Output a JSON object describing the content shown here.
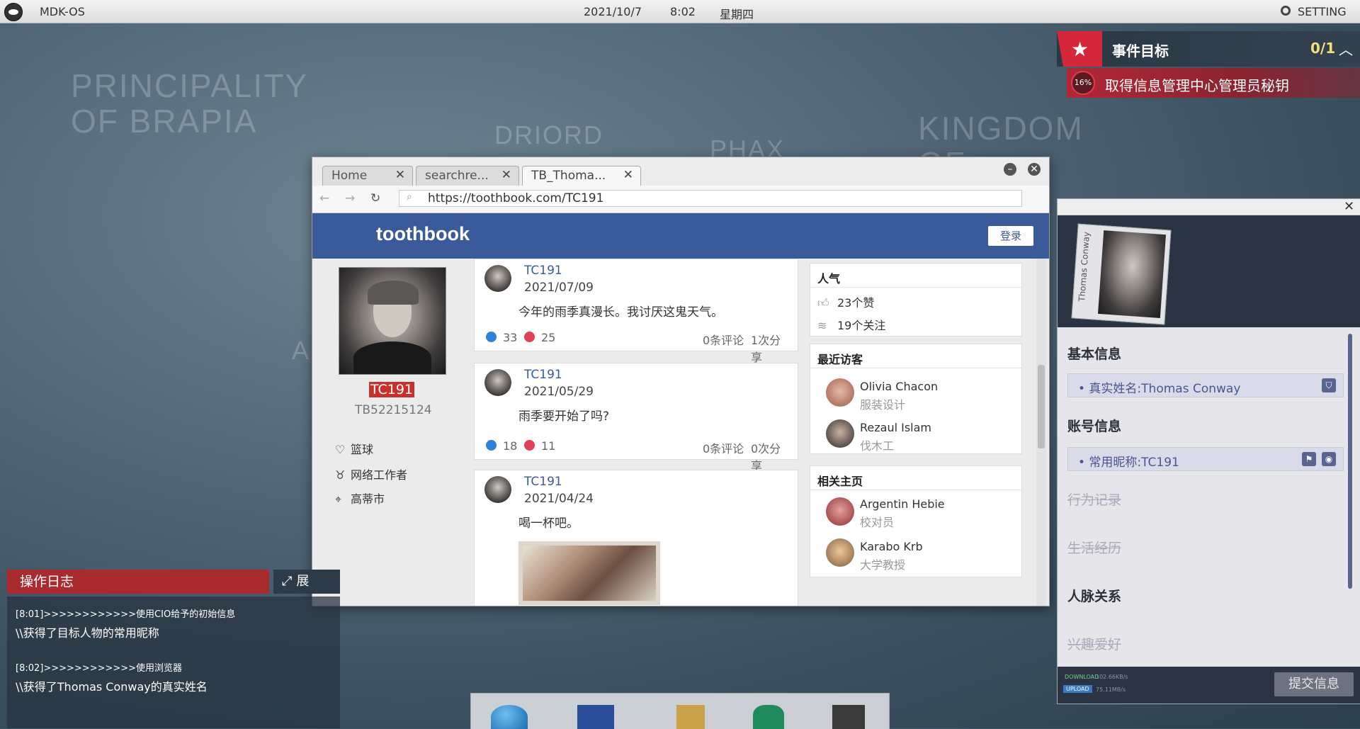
{
  "desktop": {
    "map_labels": [
      "PRINCIPALITY\nOF BRAPIA",
      "DRIORD",
      "PHAX",
      "KINGDOM OF\nORTIA",
      "A"
    ]
  },
  "topbar": {
    "os_name": "MDK-OS",
    "date": "2021/10/7",
    "time": "8:02",
    "weekday": "星期四",
    "setting": "SETTING"
  },
  "mission": {
    "title": "事件目标",
    "count": "0/1",
    "progress": "16%",
    "task": "取得信息管理中心管理员秘钥"
  },
  "browser": {
    "tabs": [
      {
        "label": "Home"
      },
      {
        "label": "searchre..."
      },
      {
        "label": "TB_Thoma..."
      }
    ],
    "url": "https://toothbook.com/TC191",
    "site_name": "toothbook",
    "login_label": "登录",
    "profile": {
      "username": "TC191",
      "user_id": "TB52215124",
      "info": [
        {
          "icon": "heart-icon",
          "text": "篮球"
        },
        {
          "icon": "tie-icon",
          "text": "网络工作者"
        },
        {
          "icon": "location-icon",
          "text": "高蒂市"
        }
      ]
    },
    "posts": [
      {
        "author": "TC191",
        "date": "2021/07/09",
        "text": "今年的雨季真漫长。我讨厌这鬼天气。",
        "likes": "33",
        "hearts": "25",
        "comments": "0条评论",
        "shares": "1次分享"
      },
      {
        "author": "TC191",
        "date": "2021/05/29",
        "text": "雨季要开始了吗?",
        "likes": "18",
        "hearts": "11",
        "comments": "0条评论",
        "shares": "0次分享"
      },
      {
        "author": "TC191",
        "date": "2021/04/24",
        "text": "喝一杯吧。"
      }
    ],
    "sidebar": {
      "popularity_title": "人气",
      "likes": "23个赞",
      "follows": "19个关注",
      "visitors_title": "最近访客",
      "visitors": [
        {
          "name": "Olivia Chacon",
          "job": "服装设计"
        },
        {
          "name": "Rezaul Islam",
          "job": "伐木工"
        }
      ],
      "related_title": "相关主页",
      "related": [
        {
          "name": "Argentin Hebie",
          "job": "校对员"
        },
        {
          "name": "Karabo Krb",
          "job": "大学教授"
        }
      ]
    }
  },
  "dossier": {
    "photo_name": "Thomas Conway",
    "basic_title": "基本信息",
    "real_name": "• 真实姓名:Thomas Conway",
    "account_title": "账号信息",
    "nickname": "• 常用昵称:TC191",
    "behavior_title": "行为记录",
    "life_title": "生活经历",
    "relations_title": "人脉关系",
    "hobby_title": "兴趣爱好",
    "download_label": "DOWNLOAD",
    "download_value": "102.66KB/s",
    "upload_label": "UPLOAD",
    "upload_value": "75.11MB/s",
    "submit_label": "提交信息"
  },
  "oplog": {
    "title": "操作日志",
    "expand_label": "展",
    "entries": [
      {
        "meta": "[8:01]>>>>>>>>>>>>使用CIO给予的初始信息",
        "msg": "\\\\获得了目标人物的常用昵称"
      },
      {
        "meta": "[8:02]>>>>>>>>>>>>使用浏览器",
        "msg": "\\\\获得了Thomas Conway的真实姓名"
      }
    ]
  },
  "dock": {
    "icons": [
      "globe-icon",
      "mail-icon",
      "sql-icon",
      "lock-icon",
      "tools-icon"
    ]
  }
}
